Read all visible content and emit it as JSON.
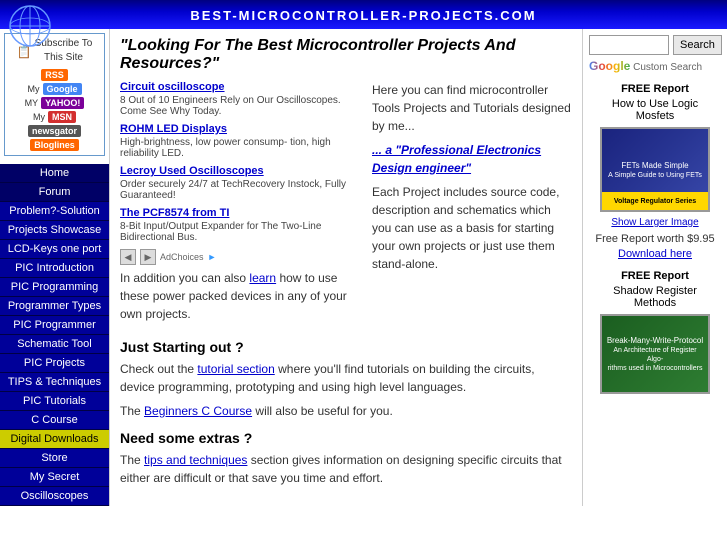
{
  "header": {
    "site_title": "best-microcontroller-projects.com"
  },
  "left_sidebar": {
    "subscribe": {
      "icon": "📋",
      "title": "Subscribe To",
      "subtitle": "This Site"
    },
    "rss_items": [
      {
        "label": "RSS",
        "class": "rss-badge"
      },
      {
        "label": "Google",
        "class": "google-badge",
        "prefix": "My"
      },
      {
        "label": "YAHOO!",
        "class": "yahoo-badge",
        "prefix": "MY"
      },
      {
        "label": "MSN",
        "class": "msn-badge",
        "prefix": "My"
      },
      {
        "label": "newsgator",
        "class": "news-badge"
      },
      {
        "label": "Bloglines",
        "class": "blog-badge"
      }
    ],
    "nav_items": [
      {
        "label": "Home",
        "class": "dark"
      },
      {
        "label": "Forum",
        "class": "dark"
      },
      {
        "label": "Problem?-Solution",
        "class": "medium"
      },
      {
        "label": "Projects Showcase",
        "class": "medium"
      },
      {
        "label": "LCD-Keys one port",
        "class": "medium"
      },
      {
        "label": "PIC Introduction",
        "class": "medium"
      },
      {
        "label": "PIC Programming",
        "class": "medium"
      },
      {
        "label": "Programmer Types",
        "class": "medium"
      },
      {
        "label": "PIC Programmer",
        "class": "medium"
      },
      {
        "label": "Schematic Tool",
        "class": "medium"
      },
      {
        "label": "PIC Projects",
        "class": "medium"
      },
      {
        "label": "TIPS & Techniques",
        "class": "medium"
      },
      {
        "label": "PIC Tutorials",
        "class": "medium"
      },
      {
        "label": "C Course",
        "class": "medium"
      },
      {
        "label": "Digital Downloads",
        "class": "yellow"
      },
      {
        "label": "Store",
        "class": "medium"
      },
      {
        "label": "My Secret",
        "class": "medium"
      },
      {
        "label": "Oscilloscopes",
        "class": "medium"
      }
    ]
  },
  "content": {
    "main_heading": "\"Looking For The Best Microcontroller Projects And Resources?\"",
    "ads": [
      {
        "title": "Circuit oscilloscope",
        "desc": "8 Out of 10 Engineers Rely on Our Oscilloscopes. Come See Why Today."
      },
      {
        "title": "ROHM LED Displays",
        "desc": "High-brightness, low power consump- tion, high reliability LED."
      },
      {
        "title": "Lecroy Used Oscilloscopes",
        "desc": "Order securely 24/7 at TechRecovery Instock, Fully Guaranteed!"
      },
      {
        "title": "The PCF8574 from TI",
        "desc": "8-Bit Input/Output Expander for The Two-Line Bidirectional Bus."
      }
    ],
    "ad_choices_label": "AdChoices",
    "right_intro": "Here you can find microcontroller Tools Projects and Tutorials designed by me...",
    "right_link": "... a \"Professional Electronics Design engineer\"",
    "right_body": "Each Project includes source code, description and schematics which you can use as a basis for starting your own projects or just use them stand-alone.",
    "learn_text": "In addition you can also learn how to use these power packed devices in any of your own projects.",
    "section1_heading": "Just Starting out ?",
    "section1_body1": "Check out the tutorial section where you'll find tutorials on building the circuits, device programming, prototyping and using high level languages.",
    "section1_body2": "The Beginners C Course will also be useful for you.",
    "section2_heading": "Need some extras ?",
    "section2_body": "The tips and techniques section gives information on designing specific circuits that either are difficult or that save you time and effort."
  },
  "right_sidebar": {
    "search_placeholder": "",
    "search_button": "Search",
    "google_custom": "Custom Search",
    "free_report1_title": "FREE Report",
    "free_report1_subtitle1": "How to Use Logic",
    "free_report1_subtitle2": "Mosfets",
    "book1_text": "FETs Made Simple",
    "show_larger": "Show Larger Image",
    "free_report_worth": "Free Report worth $9.95",
    "download_here": "Download here",
    "free_report2_title": "FREE Report",
    "free_report2_subtitle1": "Shadow Register",
    "free_report2_subtitle2": "Methods"
  }
}
